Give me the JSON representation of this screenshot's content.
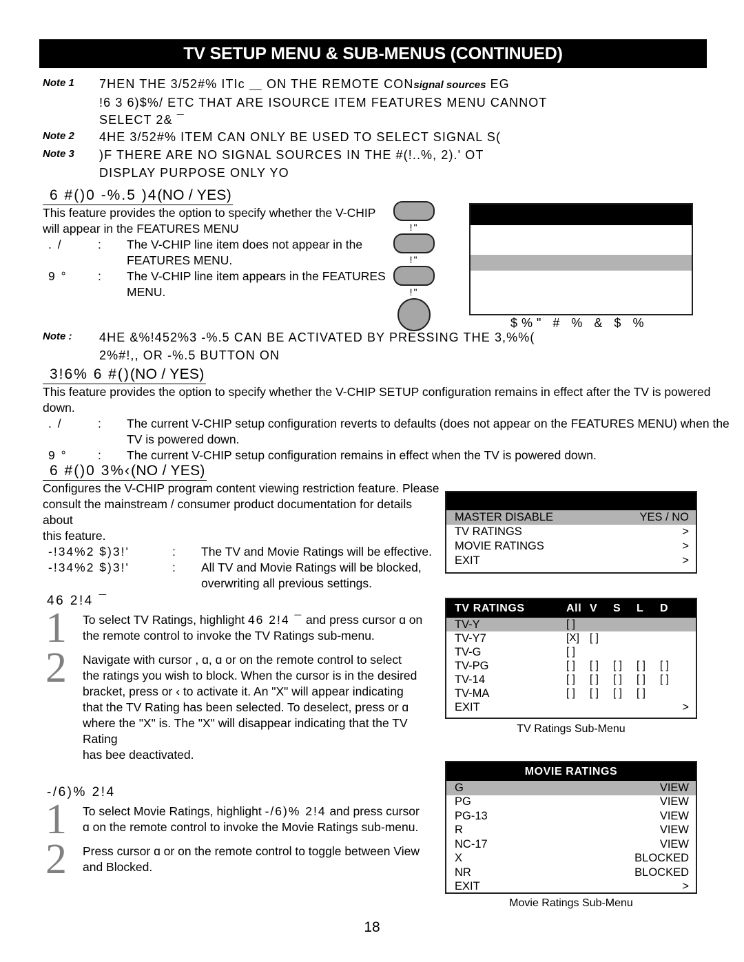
{
  "header": {
    "title": "TV SETUP MENU & SUB-MENUS (CONTINUED)"
  },
  "notes": [
    {
      "label": "Note 1",
      "line1_a": "7HEN THE 3/52#% ITIc  ⸏ ON THE REMOTE CON",
      "line1_ital": "signal sources",
      "line1_b": "  EG",
      "line2_a": "!6   3 6)$%/  ETC    THAT ARE I",
      "line2_ital1": "SOURCE",
      "line2_mid": " ITEM ",
      "line2_ital2": "FEATURES MENU",
      "line2_b": " CANNOT",
      "line3": "SELECT 2&  ¯"
    },
    {
      "label": "Note 2",
      "line1": "4HE 3/52#% ITEM CAN ONLY BE USED TO SELECT SIGNAL S("
    },
    {
      "label": "Note 3",
      "line1": ")F THERE ARE NO SIGNAL SOURCES IN THE #(!..%, 2).' OT",
      "line2": "DISPLAY PURPOSE ONLY  YO"
    }
  ],
  "vchip_menu": {
    "heading_code": "6  #()0  -%.5  )4",
    "heading_plain": "(NO / YES)",
    "intro_line1": "This feature provides the option to specify whether the V-CHIP",
    "intro_line2": "will appear in the FEATURES MENU",
    "options": [
      {
        "key": ". /",
        "colon": ":",
        "desc_line1": "The V-CHIP line item does not appear in the",
        "desc_line2": "FEATURES MENU."
      },
      {
        "key": "9 °",
        "colon": ":",
        "desc_line1": "The V-CHIP line item appears in the FEATURES",
        "desc_line2": "MENU."
      }
    ]
  },
  "remote_buttons": [
    {
      "shape": "pill",
      "caption": "!\""
    },
    {
      "shape": "pill",
      "caption": "!\""
    },
    {
      "shape": "pill",
      "caption": "!\""
    },
    {
      "shape": "circle",
      "caption": ""
    }
  ],
  "mock_menu": {
    "caption": "$%\" #   % & $          %"
  },
  "note4": {
    "label": "Note",
    "colon": ":",
    "line1": "4HE &%!452%3 -%.5 CAN BE ACTIVATED BY PRESSING THE 3,%%(",
    "line2": "2%#!,, OR -%.5 BUTTON ON"
  },
  "save_vchip": {
    "heading_code": "3!6%  6  #()",
    "heading_plain": "(NO / YES)",
    "intro_line1": "This feature provides the option to specify whether the V-CHIP SETUP configuration remains in effect after the TV is powered",
    "intro_line2": "down.",
    "options": [
      {
        "key": ". /",
        "colon": ":",
        "desc_line1": "The current V-CHIP setup configuration reverts to defaults (does not appear on the FEATURES MENU) when the",
        "desc_line2": "TV is powered down."
      },
      {
        "key": "9 °",
        "colon": ":",
        "desc_line1": "The current V-CHIP setup configuration remains in effect when the TV is powered down.",
        "desc_line2": ""
      }
    ]
  },
  "vchip_setup": {
    "heading_code": "6  #()0  3%‹",
    "heading_plain": "(NO / YES)",
    "intro_line1": "Configures the V-CHIP program content viewing restriction feature.  Please",
    "intro_line2": "consult the mainstream / consumer product documentation for details about",
    "intro_line3": "this feature.",
    "options": [
      {
        "key": "-!34%2  $)3!'",
        "colon": ":",
        "desc_line1": "The TV and Movie Ratings will be effective.",
        "desc_line2": ""
      },
      {
        "key": "-!34%2  $)3!'",
        "colon": ":",
        "desc_line1": "All TV and Movie Ratings will be blocked,",
        "desc_line2": "overwriting all previous settings."
      }
    ]
  },
  "setup_menu": {
    "title": "",
    "rows": [
      {
        "label": "MASTER DISABLE",
        "value": "YES / NO",
        "selected": true
      },
      {
        "label": "TV RATINGS",
        "value": ">",
        "selected": false
      },
      {
        "label": "MOVIE RATINGS",
        "value": ">",
        "selected": false
      },
      {
        "label": "EXIT",
        "value": ">",
        "selected": false
      }
    ]
  },
  "tv_ratings_section": {
    "heading": "46  2!4 ¯",
    "steps": [
      {
        "num": "1",
        "line1_a": "To select TV Ratings, highlight ",
        "line1_code": "46   2!4 ¯",
        "line1_b": " and press cursor ",
        "line1_cursor": "ɑ",
        "line1_c": " on",
        "line2": "the remote control to invoke the TV Ratings sub-menu."
      },
      {
        "num": "2",
        "line1": "Navigate with cursor    ,  ɑ,  ɑ or      on the remote control to select",
        "line2": "the ratings you wish to block. When the cursor is in the desired",
        "line3": "bracket, press      or  ‹ to activate it.  An \"X\" will appear indicating",
        "line4": "that the TV Rating has been selected.  To deselect, press      or  ɑ",
        "line5": "where the \"X\" is. The \"X\" will disappear indicating that the TV Rating",
        "line6": "has bee deactivated."
      }
    ]
  },
  "tv_ratings_menu": {
    "title": "TV RATINGS",
    "columns": [
      "All",
      "V",
      "S",
      "L",
      "D"
    ],
    "rows": [
      {
        "label": "TV-Y",
        "cells": [
          "[ ]",
          "",
          "",
          "",
          ""
        ],
        "selected": true,
        "arrow": ""
      },
      {
        "label": "TV-Y7",
        "cells": [
          "[X]",
          "[ ]",
          "",
          "",
          ""
        ],
        "selected": false,
        "arrow": ""
      },
      {
        "label": "TV-G",
        "cells": [
          "[ ]",
          "",
          "",
          "",
          ""
        ],
        "selected": false,
        "arrow": ""
      },
      {
        "label": "TV-PG",
        "cells": [
          "[ ]",
          "[ ]",
          "[ ]",
          "[ ]",
          "[ ]"
        ],
        "selected": false,
        "arrow": ""
      },
      {
        "label": "TV-14",
        "cells": [
          "[ ]",
          "[ ]",
          "[ ]",
          "[ ]",
          "[ ]"
        ],
        "selected": false,
        "arrow": ""
      },
      {
        "label": "TV-MA",
        "cells": [
          "[ ]",
          "[ ]",
          "[ ]",
          "[ ]",
          ""
        ],
        "selected": false,
        "arrow": ""
      },
      {
        "label": "EXIT",
        "cells": [
          "",
          "",
          "",
          "",
          ""
        ],
        "selected": false,
        "arrow": ">"
      }
    ],
    "caption": "TV Ratings Sub-Menu"
  },
  "movie_ratings_section": {
    "heading": "-/6)%  2!4",
    "steps": [
      {
        "num": "1",
        "line1_a": "To select Movie Ratings, highlight ",
        "line1_code": "-/6)%  2!4",
        "line1_b": " and press cursor",
        "line2_cursor": "ɑ",
        "line2": " on the remote control to invoke the Movie Ratings sub-menu."
      },
      {
        "num": "2",
        "line1_a": "Press cursor ",
        "line1_cursor": "ɑ",
        "line1_b": " or      on the remote control to toggle between View",
        "line2": "and Blocked."
      }
    ]
  },
  "movie_ratings_menu": {
    "title": "MOVIE RATINGS",
    "rows": [
      {
        "label": "G",
        "value": "VIEW",
        "selected": true
      },
      {
        "label": "PG",
        "value": "VIEW",
        "selected": false
      },
      {
        "label": "PG-13",
        "value": "VIEW",
        "selected": false
      },
      {
        "label": "R",
        "value": "VIEW",
        "selected": false
      },
      {
        "label": "NC-17",
        "value": "VIEW",
        "selected": false
      },
      {
        "label": "X",
        "value": "BLOCKED",
        "selected": false
      },
      {
        "label": "NR",
        "value": "BLOCKED",
        "selected": false
      },
      {
        "label": "EXIT",
        "value": ">",
        "selected": false
      }
    ],
    "caption": "Movie Ratings Sub-Menu"
  },
  "footer": {
    "page_number": "18"
  },
  "colors": {
    "header_bar": "#000000",
    "selected_row": "#b3b3b3",
    "step_number": "#808080",
    "button_fill": "#a6a6a6"
  }
}
